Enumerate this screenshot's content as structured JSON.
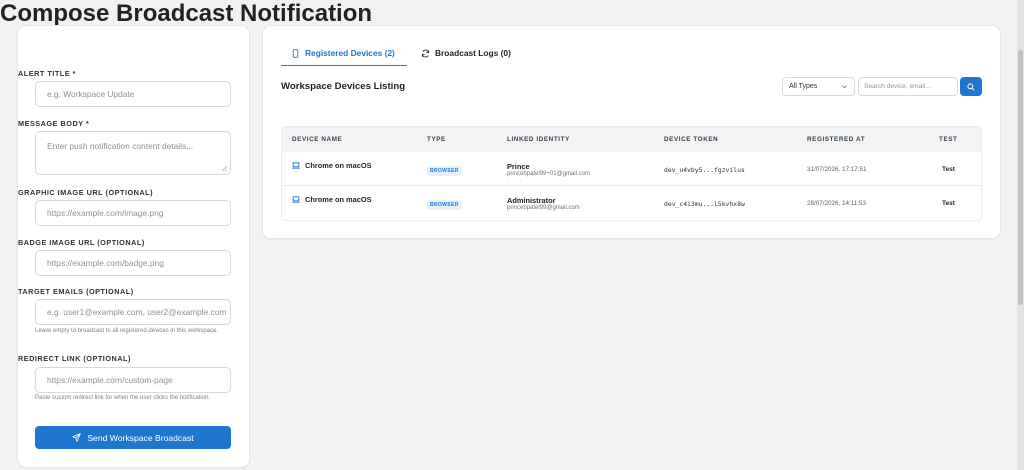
{
  "compose": {
    "title": "Compose Broadcast Notification",
    "alert_title": {
      "label": "ALERT TITLE *",
      "placeholder": "e.g. Workspace Update"
    },
    "message_body": {
      "label": "MESSAGE BODY *",
      "placeholder": "Enter push notification content details..."
    },
    "graphic_image": {
      "label": "GRAPHIC IMAGE URL (OPTIONAL)",
      "placeholder": "https://example.com/image.png"
    },
    "badge_image": {
      "label": "BADGE IMAGE URL (OPTIONAL)",
      "placeholder": "https://example.com/badge.png"
    },
    "target_emails": {
      "label": "TARGET EMAILS (OPTIONAL)",
      "placeholder": "e.g. user1@example.com, user2@example.com",
      "hint": "Leave empty to broadcast to all registered devices in this workspace."
    },
    "redirect_link": {
      "label": "REDIRECT LINK (OPTIONAL)",
      "placeholder": "https://example.com/custom-page",
      "hint": "Paste custom redirect link for when the user clicks the notification."
    },
    "send_label": "Send Workspace Broadcast"
  },
  "tabs": {
    "registered": "Registered Devices (2)",
    "logs": "Broadcast Logs (0)"
  },
  "listing": {
    "title": "Workspace Devices Listing",
    "filter_value": "All Types",
    "search_placeholder": "Search device, email..."
  },
  "table": {
    "headers": {
      "device": "DEVICE NAME",
      "type": "TYPE",
      "identity": "LINKED IDENTITY",
      "token": "DEVICE TOKEN",
      "registered": "REGISTERED AT",
      "test": "TEST"
    },
    "rows": [
      {
        "device": "Chrome on macOS",
        "type": "BROWSER",
        "name": "Prince",
        "email": "princebpatel99+01@gmail.com",
        "token": "dev_u4vby5...fgzvilus",
        "registered": "31/07/2026, 17:17:51",
        "test": "Test"
      },
      {
        "device": "Chrome on macOS",
        "type": "BROWSER",
        "name": "Administrator",
        "email": "princebpatel99@gmail.com",
        "token": "dev_c4i3mu...l5kvhx8w",
        "registered": "28/07/2026, 14:11:53",
        "test": "Test"
      }
    ]
  },
  "colors": {
    "accent": "#1f76cf",
    "background": "#f2f1f0",
    "badge_bg": "#e6f0fb"
  },
  "icons": {
    "tab_registered": "mobile-device-icon",
    "tab_logs": "refresh-icon",
    "send": "paper-plane-icon",
    "search": "search-icon",
    "device": "laptop-icon",
    "select": "chevron-down-icon"
  }
}
